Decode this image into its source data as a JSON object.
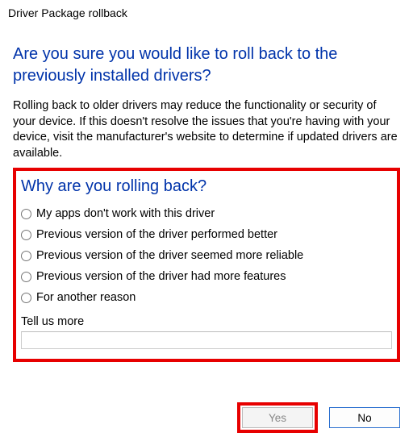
{
  "window": {
    "title": "Driver Package rollback"
  },
  "heading": "Are you sure you would like to roll back to the previously installed drivers?",
  "warning": "Rolling back to older drivers may reduce the functionality or security of your device. If this doesn't resolve the issues that you're having with your device, visit the manufacturer's website to determine if updated drivers are available.",
  "reason": {
    "heading": "Why are you rolling back?",
    "options": [
      "My apps don't work with this driver",
      "Previous version of the driver performed better",
      "Previous version of the driver seemed more reliable",
      "Previous version of the driver had more features",
      "For another reason"
    ],
    "tellus_label": "Tell us more",
    "tellus_value": ""
  },
  "buttons": {
    "yes": "Yes",
    "no": "No"
  },
  "highlight_color": "#e70000"
}
